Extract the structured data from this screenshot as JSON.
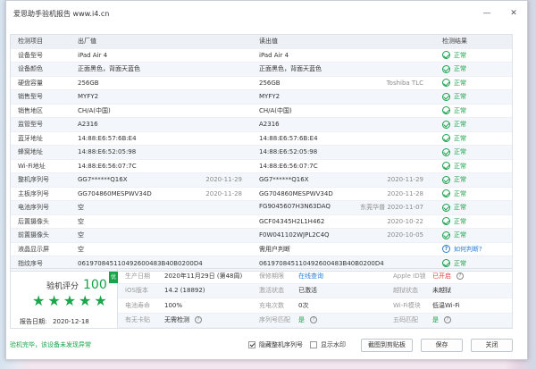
{
  "window": {
    "title": "爱思助手验机报告 www.i4.cn",
    "min": "—",
    "close": "✕"
  },
  "table": {
    "headers": [
      "检测项目",
      "出厂值",
      "读出值",
      "检测结果"
    ],
    "rows": [
      {
        "item": "设备型号",
        "factory": "iPad Air 4",
        "factory_note": "",
        "read": "iPad Air 4",
        "read_note": "",
        "result": "正常",
        "icon": "check"
      },
      {
        "item": "设备颜色",
        "factory": "正面黑色，背面天蓝色",
        "factory_note": "",
        "read": "正面黑色，背面天蓝色",
        "read_note": "",
        "result": "正常",
        "icon": "check"
      },
      {
        "item": "硬盘容量",
        "factory": "256GB",
        "factory_note": "",
        "read": "256GB",
        "read_note": "Toshiba TLC",
        "result": "正常",
        "icon": "check"
      },
      {
        "item": "销售型号",
        "factory": "MYFY2",
        "factory_note": "",
        "read": "MYFY2",
        "read_note": "",
        "result": "正常",
        "icon": "check"
      },
      {
        "item": "销售地区",
        "factory": "CH/A(中国)",
        "factory_note": "",
        "read": "CH/A(中国)",
        "read_note": "",
        "result": "正常",
        "icon": "check"
      },
      {
        "item": "监管型号",
        "factory": "A2316",
        "factory_note": "",
        "read": "A2316",
        "read_note": "",
        "result": "正常",
        "icon": "check"
      },
      {
        "item": "蓝牙地址",
        "factory": "14:88:E6:57:6B:E4",
        "factory_note": "",
        "read": "14:88:E6:57:6B:E4",
        "read_note": "",
        "result": "正常",
        "icon": "check"
      },
      {
        "item": "蜂窝地址",
        "factory": "14:88:E6:52:05:98",
        "factory_note": "",
        "read": "14:88:E6:52:05:98",
        "read_note": "",
        "result": "正常",
        "icon": "check"
      },
      {
        "item": "Wi-Fi地址",
        "factory": "14:88:E6:56:07:7C",
        "factory_note": "",
        "read": "14:88:E6:56:07:7C",
        "read_note": "",
        "result": "正常",
        "icon": "check"
      },
      {
        "item": "整机序列号",
        "factory": "GG7******Q16X",
        "factory_note": "2020-11-29",
        "read": "GG7******Q16X",
        "read_note": "2020-11-29",
        "result": "正常",
        "icon": "check"
      },
      {
        "item": "主板序列号",
        "factory": "GG704860MESPWV34D",
        "factory_note": "2020-11-28",
        "read": "GG704860MESPWV34D",
        "read_note": "2020-11-28",
        "result": "正常",
        "icon": "check"
      },
      {
        "item": "电池序列号",
        "factory": "空",
        "factory_note": "",
        "read": "FG9045607H3N63DAQ",
        "read_note": "东莞华普 2020-11-07",
        "result": "正常",
        "icon": "check"
      },
      {
        "item": "后置摄像头",
        "factory": "空",
        "factory_note": "",
        "read": "GCF04345H2L1H462",
        "read_note": "2020-10-22",
        "result": "正常",
        "icon": "check"
      },
      {
        "item": "前置摄像头",
        "factory": "空",
        "factory_note": "",
        "read": "F0W041102WJPL2C4Q",
        "read_note": "2020-10-05",
        "result": "正常",
        "icon": "check"
      },
      {
        "item": "液晶显示屏",
        "factory": "空",
        "factory_note": "",
        "read": "需用户判断",
        "read_note": "",
        "result": "如何判断?",
        "icon": "question"
      },
      {
        "item": "指纹序号",
        "factory": "061970845110492600483B40B0200D4",
        "factory_note": "",
        "read": "061970845110492600483B40B0200D4",
        "read_note": "",
        "result": "正常",
        "icon": "check"
      }
    ]
  },
  "summary": {
    "score_label": "验机评分",
    "score": "100",
    "badge": "优",
    "stars": "★★★★★",
    "report_date_label": "报告日期:",
    "report_date": "2020-12-18",
    "cells": [
      {
        "label": "生产日期",
        "value": "2020年11月29日 (第48周)",
        "cls": "val"
      },
      {
        "label": "保修期限",
        "value": "在线查询",
        "cls": "blue"
      },
      {
        "label": "Apple ID锁",
        "value": "已开启",
        "cls": "red",
        "ring": "?"
      },
      {
        "label": "iOS版本",
        "value": "14.2 (18892)",
        "cls": "val"
      },
      {
        "label": "激活状态",
        "value": "已激活",
        "cls": "val"
      },
      {
        "label": "越狱状态",
        "value": "未越狱",
        "cls": "val"
      },
      {
        "label": "电池寿命",
        "value": "100%",
        "cls": "val"
      },
      {
        "label": "充电次数",
        "value": "0次",
        "cls": "val"
      },
      {
        "label": "Wi-Fi模块",
        "value": "低温Wi-Fi",
        "cls": "val"
      },
      {
        "label": "有无卡贴",
        "value": "无需检测",
        "cls": "val",
        "ring": "?"
      },
      {
        "label": "序列号匹配",
        "value": "是",
        "cls": "green",
        "ring": "?"
      },
      {
        "label": "五码匹配",
        "value": "是",
        "cls": "green",
        "ring": "?"
      }
    ]
  },
  "footer": {
    "pass_text": "验机完毕，该设备未发现异常",
    "hide_serial_label": "隐藏整机序列号",
    "show_watermark_label": "显示水印",
    "screenshot_label": "截图到剪贴板",
    "save_label": "保存",
    "close_label": "关闭"
  }
}
